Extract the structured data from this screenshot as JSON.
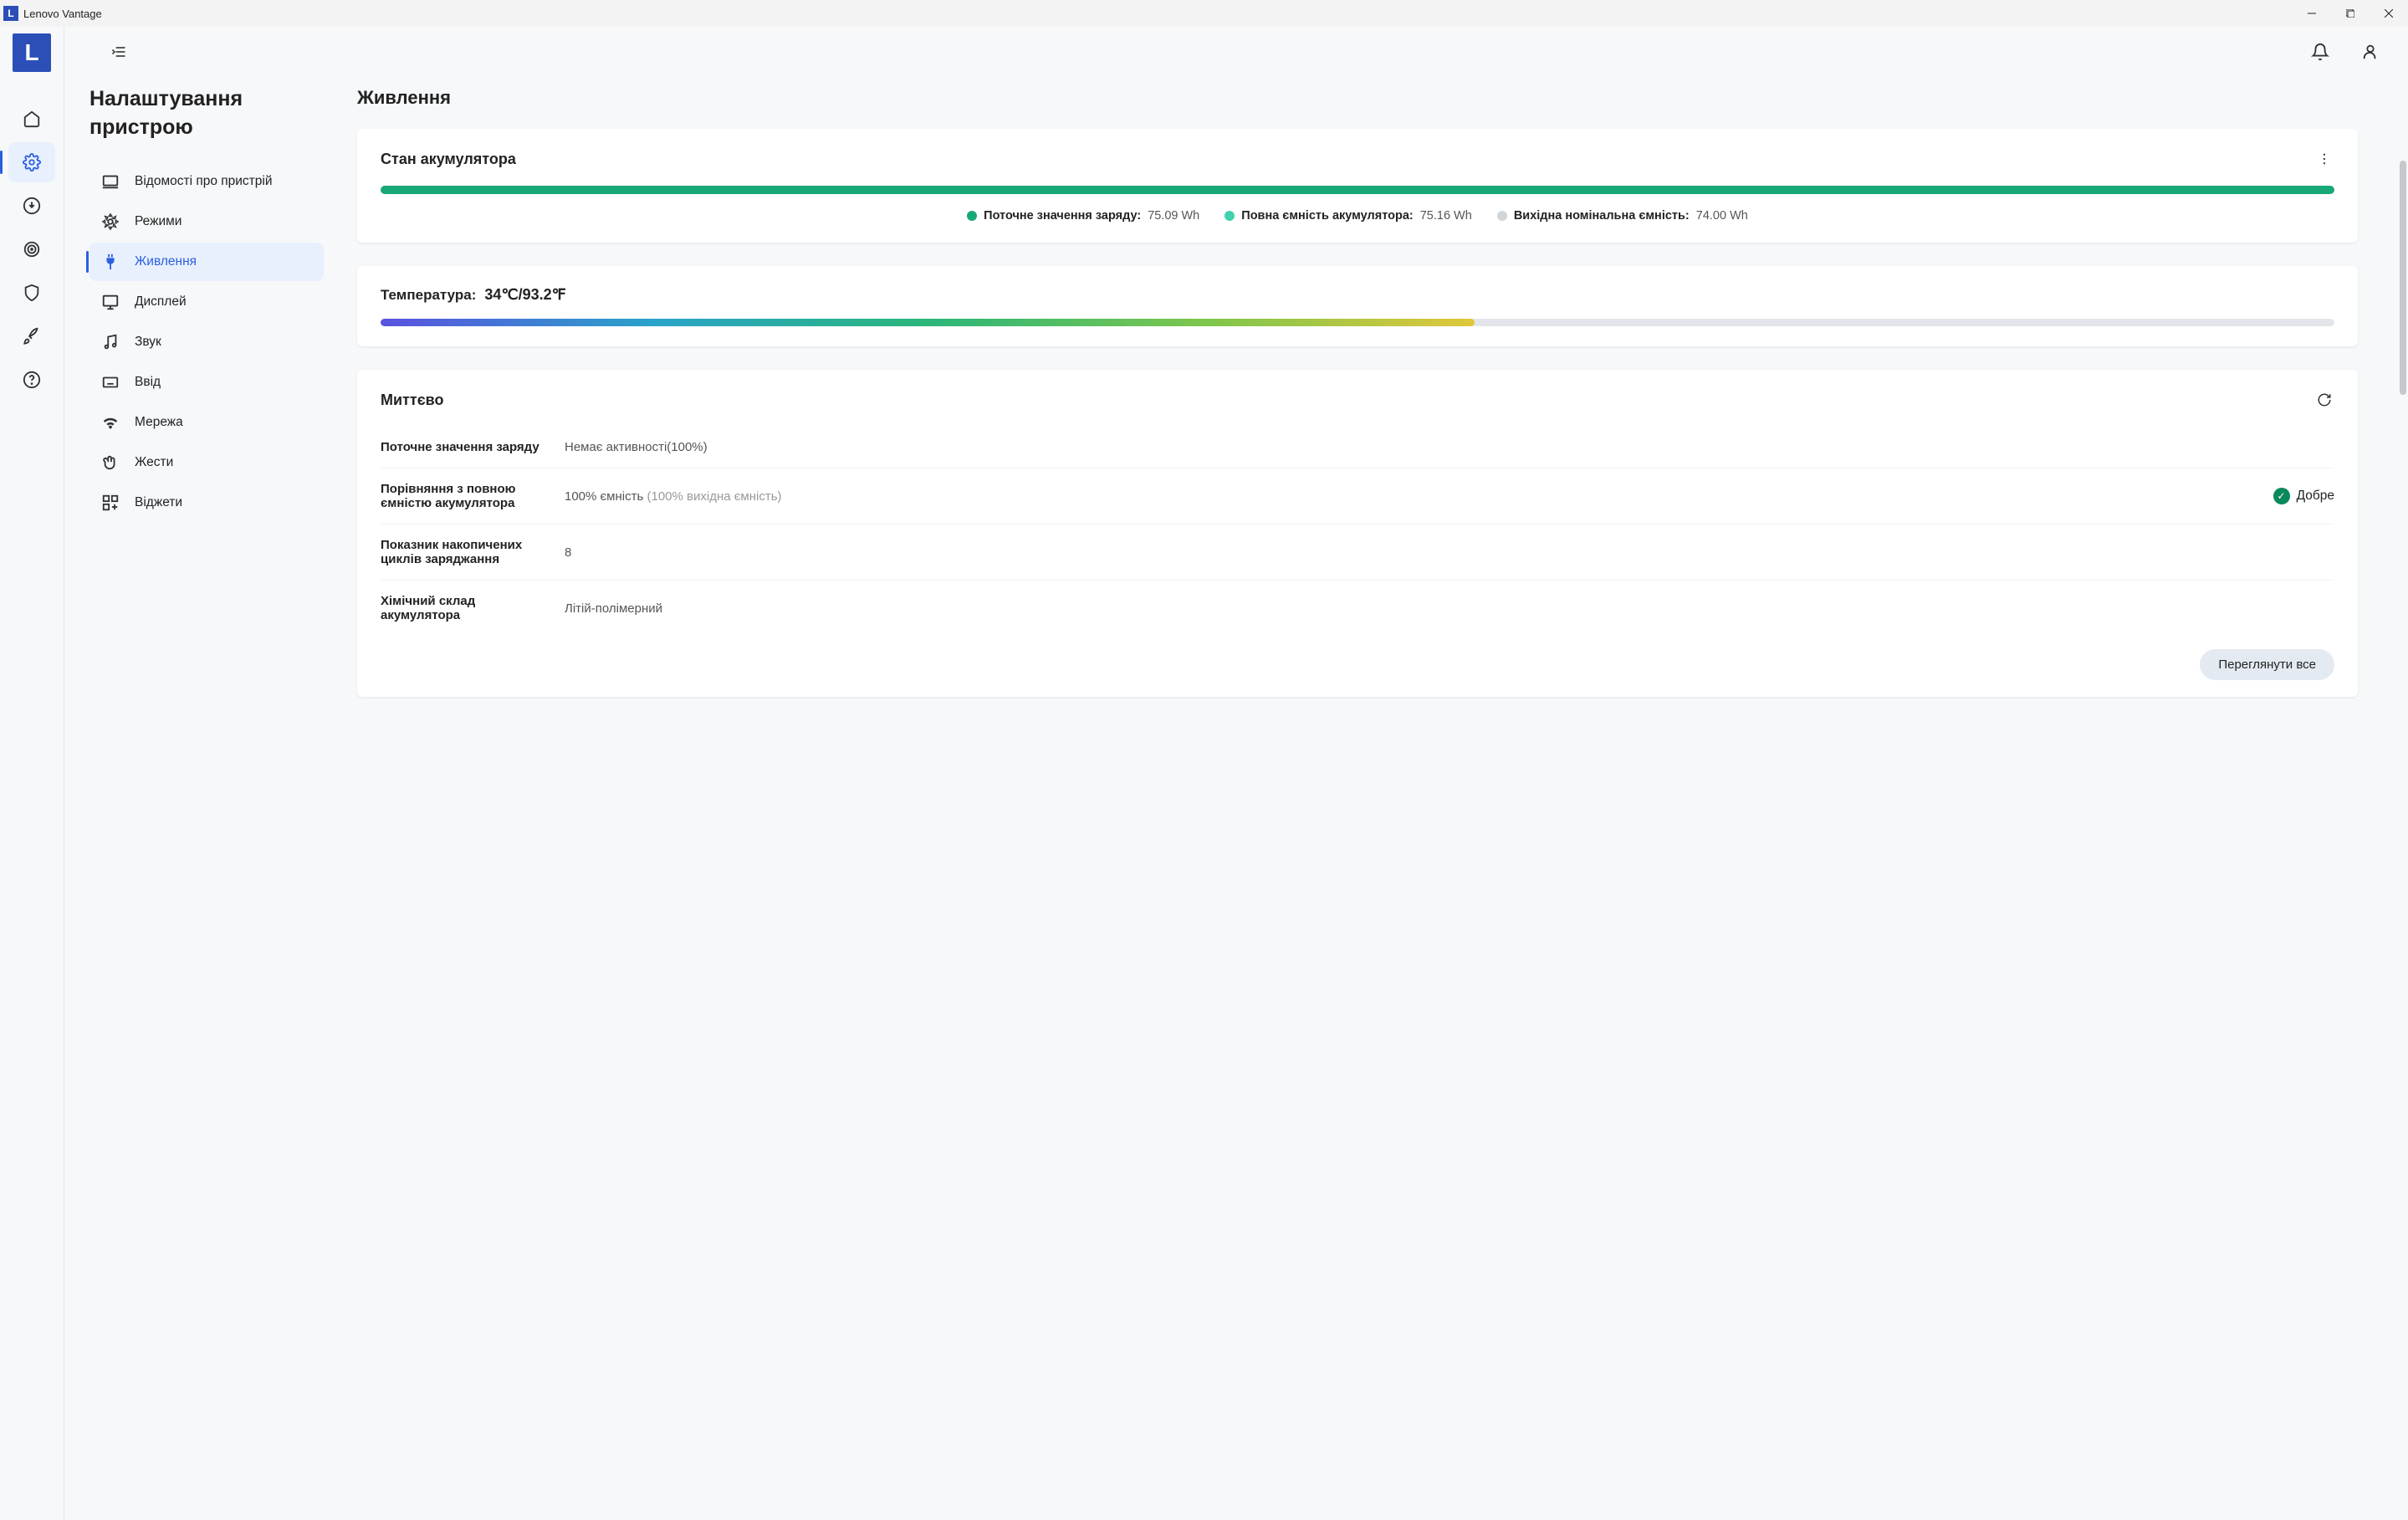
{
  "window": {
    "title": "Lenovo Vantage"
  },
  "sidepanel": {
    "title": "Налаштування пристрою",
    "items": [
      {
        "label": "Відомості про пристрій"
      },
      {
        "label": "Режими"
      },
      {
        "label": "Живлення"
      },
      {
        "label": "Дисплей"
      },
      {
        "label": "Звук"
      },
      {
        "label": "Ввід"
      },
      {
        "label": "Мережа"
      },
      {
        "label": "Жести"
      },
      {
        "label": "Віджети"
      }
    ]
  },
  "main": {
    "title": "Живлення",
    "battery_state": {
      "title": "Стан акумулятора",
      "current_charge_label": "Поточне значення заряду:",
      "current_charge_value": "75.09 Wh",
      "full_capacity_label": "Повна ємність акумулятора:",
      "full_capacity_value": "75.16 Wh",
      "design_capacity_label": "Вихідна номінальна ємність:",
      "design_capacity_value": "74.00 Wh"
    },
    "temperature": {
      "label": "Температура:",
      "value": "34℃/93.2℉"
    },
    "instant": {
      "title": "Миттєво",
      "rows": {
        "current_charge": {
          "label": "Поточне значення заряду",
          "value": "Немає активності(100%)"
        },
        "capacity_compare": {
          "label": "Порівняння з повною ємністю акумулятора",
          "value": "100% ємність",
          "muted": "(100% вихідна ємність)",
          "status": "Добре"
        },
        "cycles": {
          "label": "Показник накопичених циклів заряджання",
          "value": "8"
        },
        "chemistry": {
          "label": "Хімічний склад акумулятора",
          "value": "Літій-полімерний"
        }
      },
      "view_all": "Переглянути все"
    }
  }
}
